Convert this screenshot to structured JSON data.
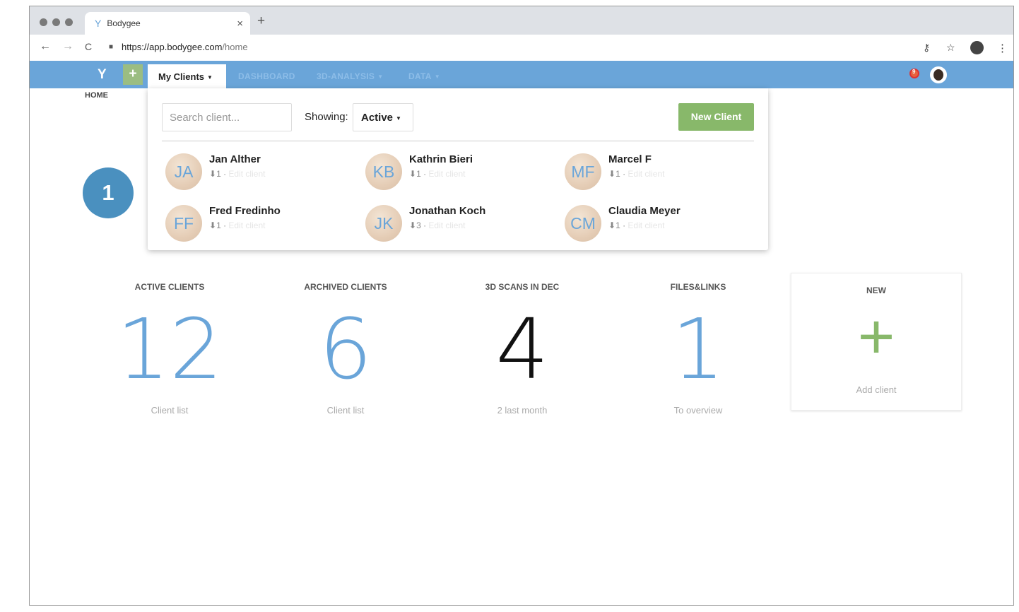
{
  "browser": {
    "tab_title": "Bodygee",
    "tab_close": "×",
    "new_tab": "+",
    "url_host": "https://app.bodygee.com",
    "url_path": "/home",
    "nav_back": "←",
    "nav_forward": "→",
    "nav_reload": "C",
    "key_icon": "⚷",
    "star_icon": "☆",
    "menu_icon": "⋮"
  },
  "appnav": {
    "logo": "Y",
    "add": "+",
    "my_clients": "My Clients",
    "links": [
      "DASHBOARD",
      "3D-ANALYSIS",
      "DATA"
    ],
    "notification_count": "9"
  },
  "breadcrumb": "HOME",
  "dropdown": {
    "search_placeholder": "Search client...",
    "showing_label": "Showing:",
    "showing_value": "Active",
    "new_client": "New Client",
    "clients": [
      {
        "initials": "JA",
        "name": "Jan Alther",
        "count": "1",
        "edit": "Edit client"
      },
      {
        "initials": "KB",
        "name": "Kathrin Bieri",
        "count": "1",
        "edit": "Edit client"
      },
      {
        "initials": "MF",
        "name": "Marcel F",
        "count": "1",
        "edit": "Edit client"
      },
      {
        "initials": "FF",
        "name": "Fred Fredinho",
        "count": "1",
        "edit": "Edit client"
      },
      {
        "initials": "JK",
        "name": "Jonathan Koch",
        "count": "3",
        "edit": "Edit client"
      },
      {
        "initials": "CM",
        "name": "Claudia Meyer",
        "count": "1",
        "edit": "Edit client"
      }
    ]
  },
  "step_badge": "1",
  "stats": [
    {
      "label": "ACTIVE CLIENTS",
      "value": "12",
      "sub": "Client list",
      "color": "#6aa5d9"
    },
    {
      "label": "ARCHIVED CLIENTS",
      "value": "6",
      "sub": "Client list",
      "color": "#6aa5d9"
    },
    {
      "label": "3D SCANS IN DEC",
      "value": "4",
      "sub": "2 last month",
      "color": "#111111"
    },
    {
      "label": "FILES&LINKS",
      "value": "1",
      "sub": "To overview",
      "color": "#6aa5d9"
    }
  ],
  "new_card": {
    "label": "NEW",
    "icon": "+",
    "sub": "Add client"
  },
  "colors": {
    "brand": "#6aa5d9",
    "accent_green": "#88b86a"
  }
}
